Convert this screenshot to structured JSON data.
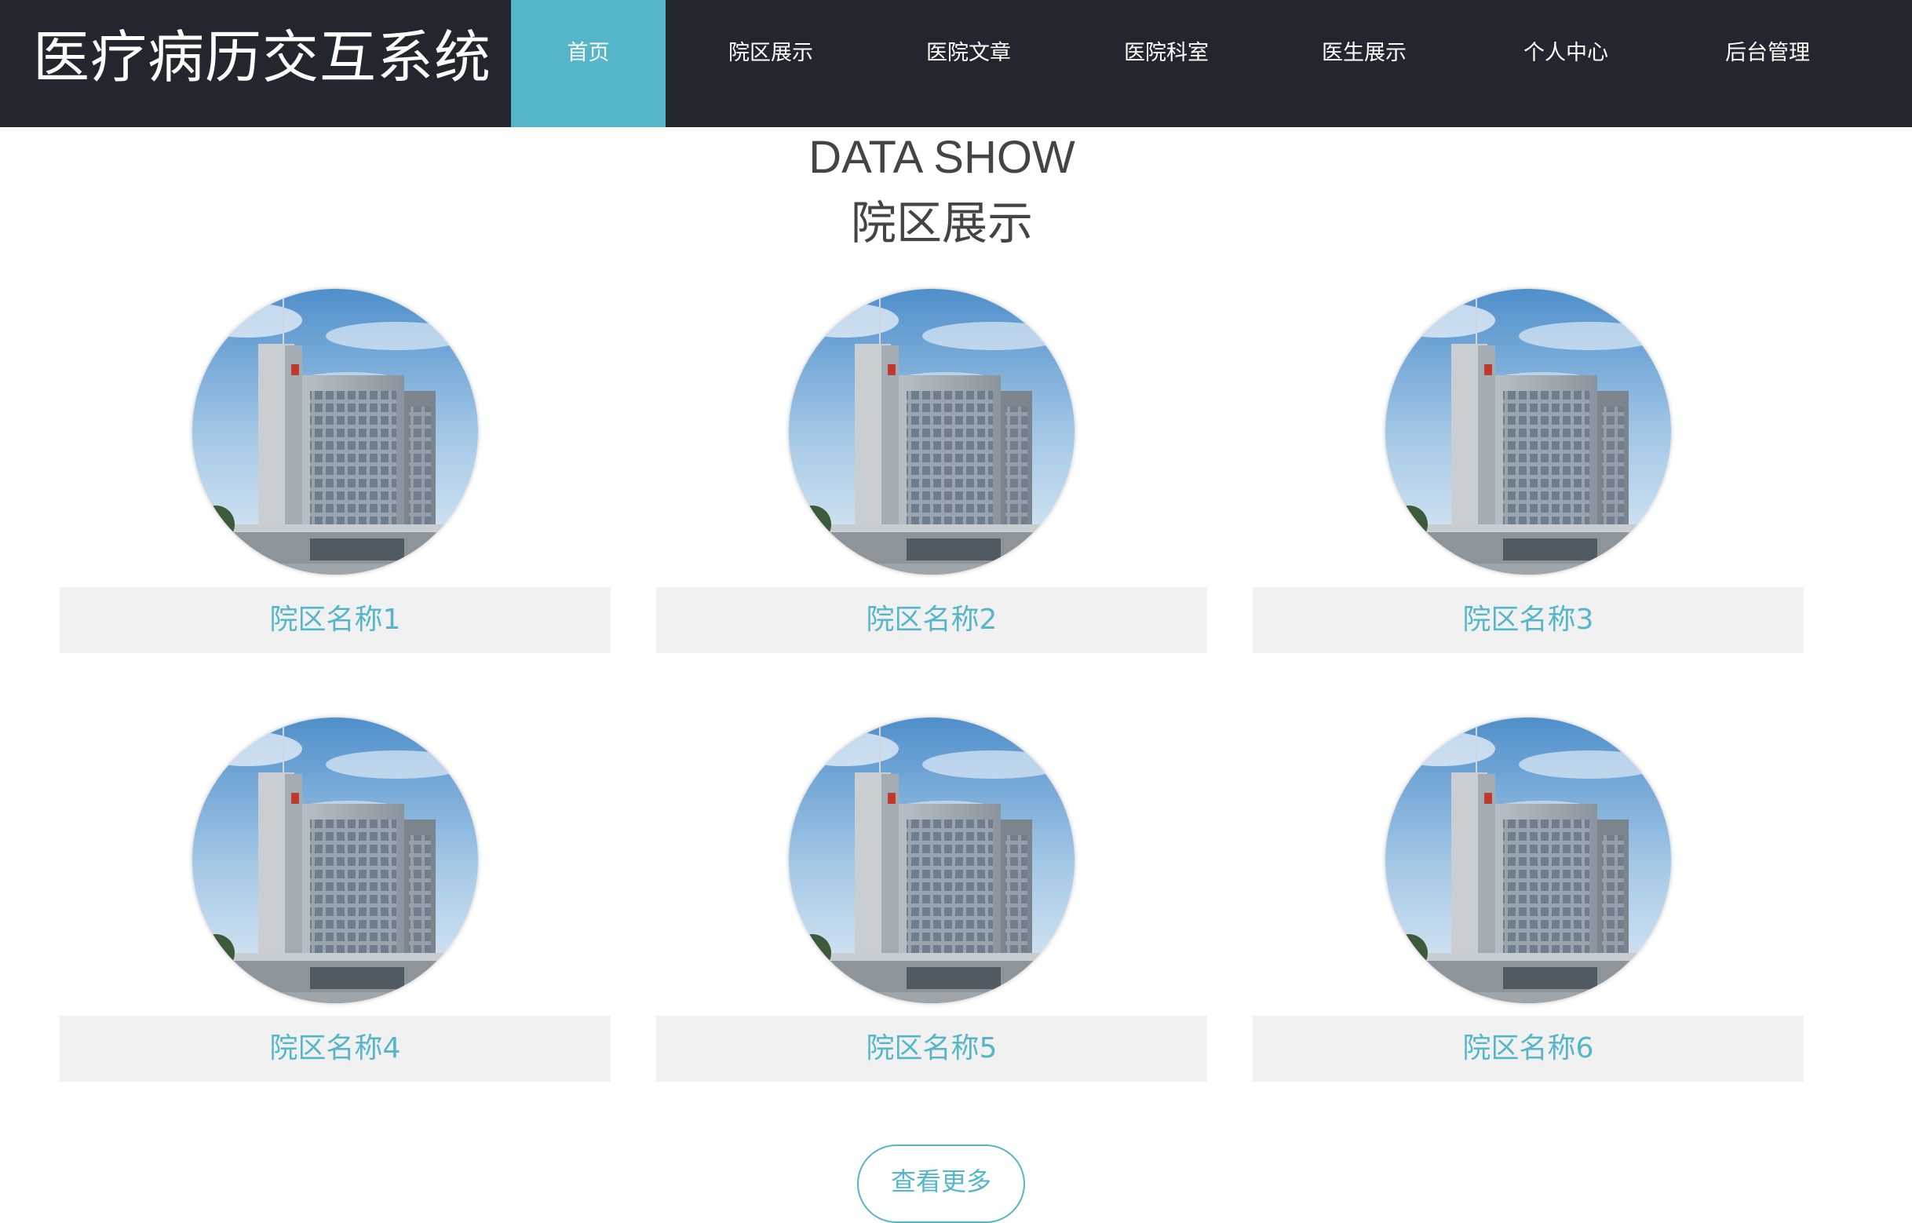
{
  "header": {
    "site_title": "医疗病历交互系统",
    "nav": [
      {
        "label": "首页",
        "active": true
      },
      {
        "label": "院区展示",
        "active": false
      },
      {
        "label": "医院文章",
        "active": false
      },
      {
        "label": "医院科室",
        "active": false
      },
      {
        "label": "医生展示",
        "active": false
      },
      {
        "label": "个人中心",
        "active": false
      },
      {
        "label": "后台管理",
        "active": false
      }
    ]
  },
  "section": {
    "title_en": "DATA SHOW",
    "title_zh": "院区展示"
  },
  "campuses": [
    {
      "name": "院区名称1"
    },
    {
      "name": "院区名称2"
    },
    {
      "name": "院区名称3"
    },
    {
      "name": "院区名称4"
    },
    {
      "name": "院区名称5"
    },
    {
      "name": "院区名称6"
    }
  ],
  "more_button": "查看更多",
  "colors": {
    "header_bg": "#22262f",
    "accent": "#54b6c8",
    "label_bg": "#f1f1f1"
  }
}
